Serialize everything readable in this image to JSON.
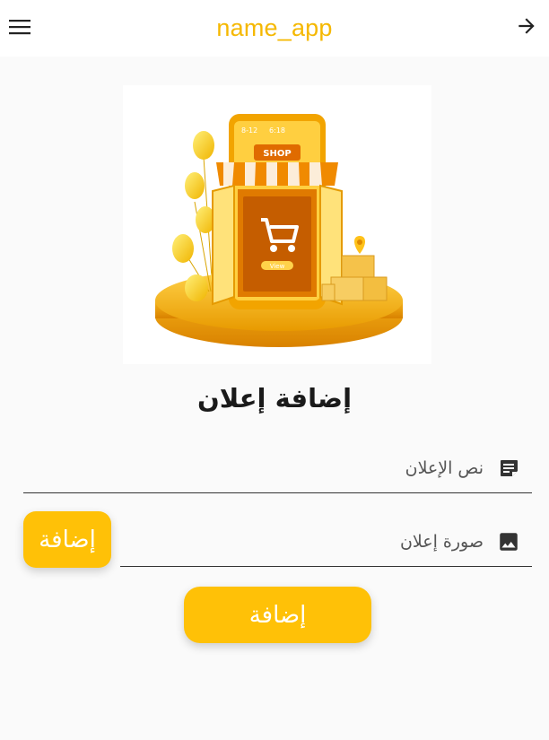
{
  "app_bar": {
    "title": "name_app",
    "menu_icon": "menu-icon",
    "back_icon": "arrow-forward-icon"
  },
  "hero": {
    "shop_sign": "SHOP",
    "phone_left_time": "8-12",
    "phone_right_time": "6:18",
    "view_label": "View"
  },
  "page": {
    "title": "إضافة إعلان"
  },
  "form": {
    "ad_text": {
      "placeholder": "نص الإعلان",
      "value": "",
      "icon": "notes-icon"
    },
    "ad_image": {
      "placeholder": "صورة إعلان",
      "value": "",
      "icon": "image-icon"
    },
    "pick_image_label": "إضافة",
    "submit_label": "إضافة"
  },
  "colors": {
    "accent": "#ffc107",
    "title": "#f5b800",
    "background": "#fafafa"
  }
}
